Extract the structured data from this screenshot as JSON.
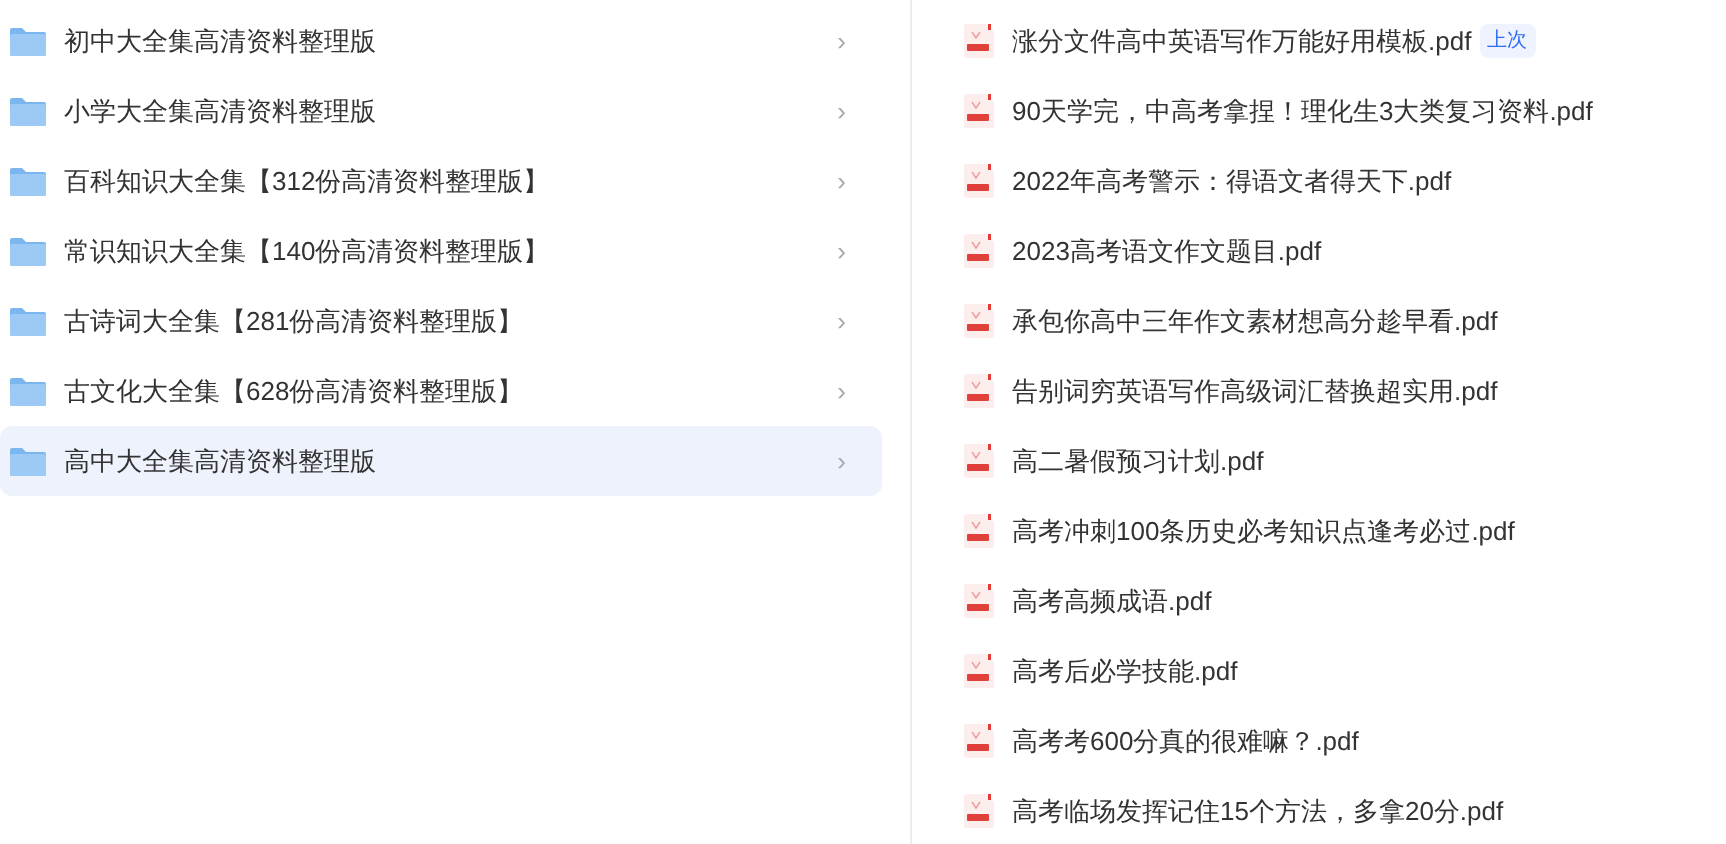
{
  "folders": [
    {
      "name": "初中大全集高清资料整理版",
      "selected": false
    },
    {
      "name": "小学大全集高清资料整理版",
      "selected": false
    },
    {
      "name": "百科知识大全集【312份高清资料整理版】",
      "selected": false
    },
    {
      "name": "常识知识大全集【140份高清资料整理版】",
      "selected": false
    },
    {
      "name": "古诗词大全集【281份高清资料整理版】",
      "selected": false
    },
    {
      "name": "古文化大全集【628份高清资料整理版】",
      "selected": false
    },
    {
      "name": "高中大全集高清资料整理版",
      "selected": true
    }
  ],
  "chevron": "›",
  "files": [
    {
      "name": "涨分文件高中英语写作万能好用模板.pdf",
      "badge": "上次"
    },
    {
      "name": "90天学完，中高考拿捏！理化生3大类复习资料.pdf"
    },
    {
      "name": "2022年高考警示：得语文者得天下.pdf"
    },
    {
      "name": "2023高考语文作文题目.pdf"
    },
    {
      "name": "承包你高中三年作文素材想高分趁早看.pdf"
    },
    {
      "name": "告别词穷英语写作高级词汇替换超实用.pdf"
    },
    {
      "name": "高二暑假预习计划.pdf"
    },
    {
      "name": "高考冲刺100条历史必考知识点逢考必过.pdf"
    },
    {
      "name": "高考高频成语.pdf"
    },
    {
      "name": "高考后必学技能.pdf"
    },
    {
      "name": "高考考600分真的很难嘛？.pdf"
    },
    {
      "name": "高考临场发挥记住15个方法，多拿20分.pdf"
    }
  ]
}
